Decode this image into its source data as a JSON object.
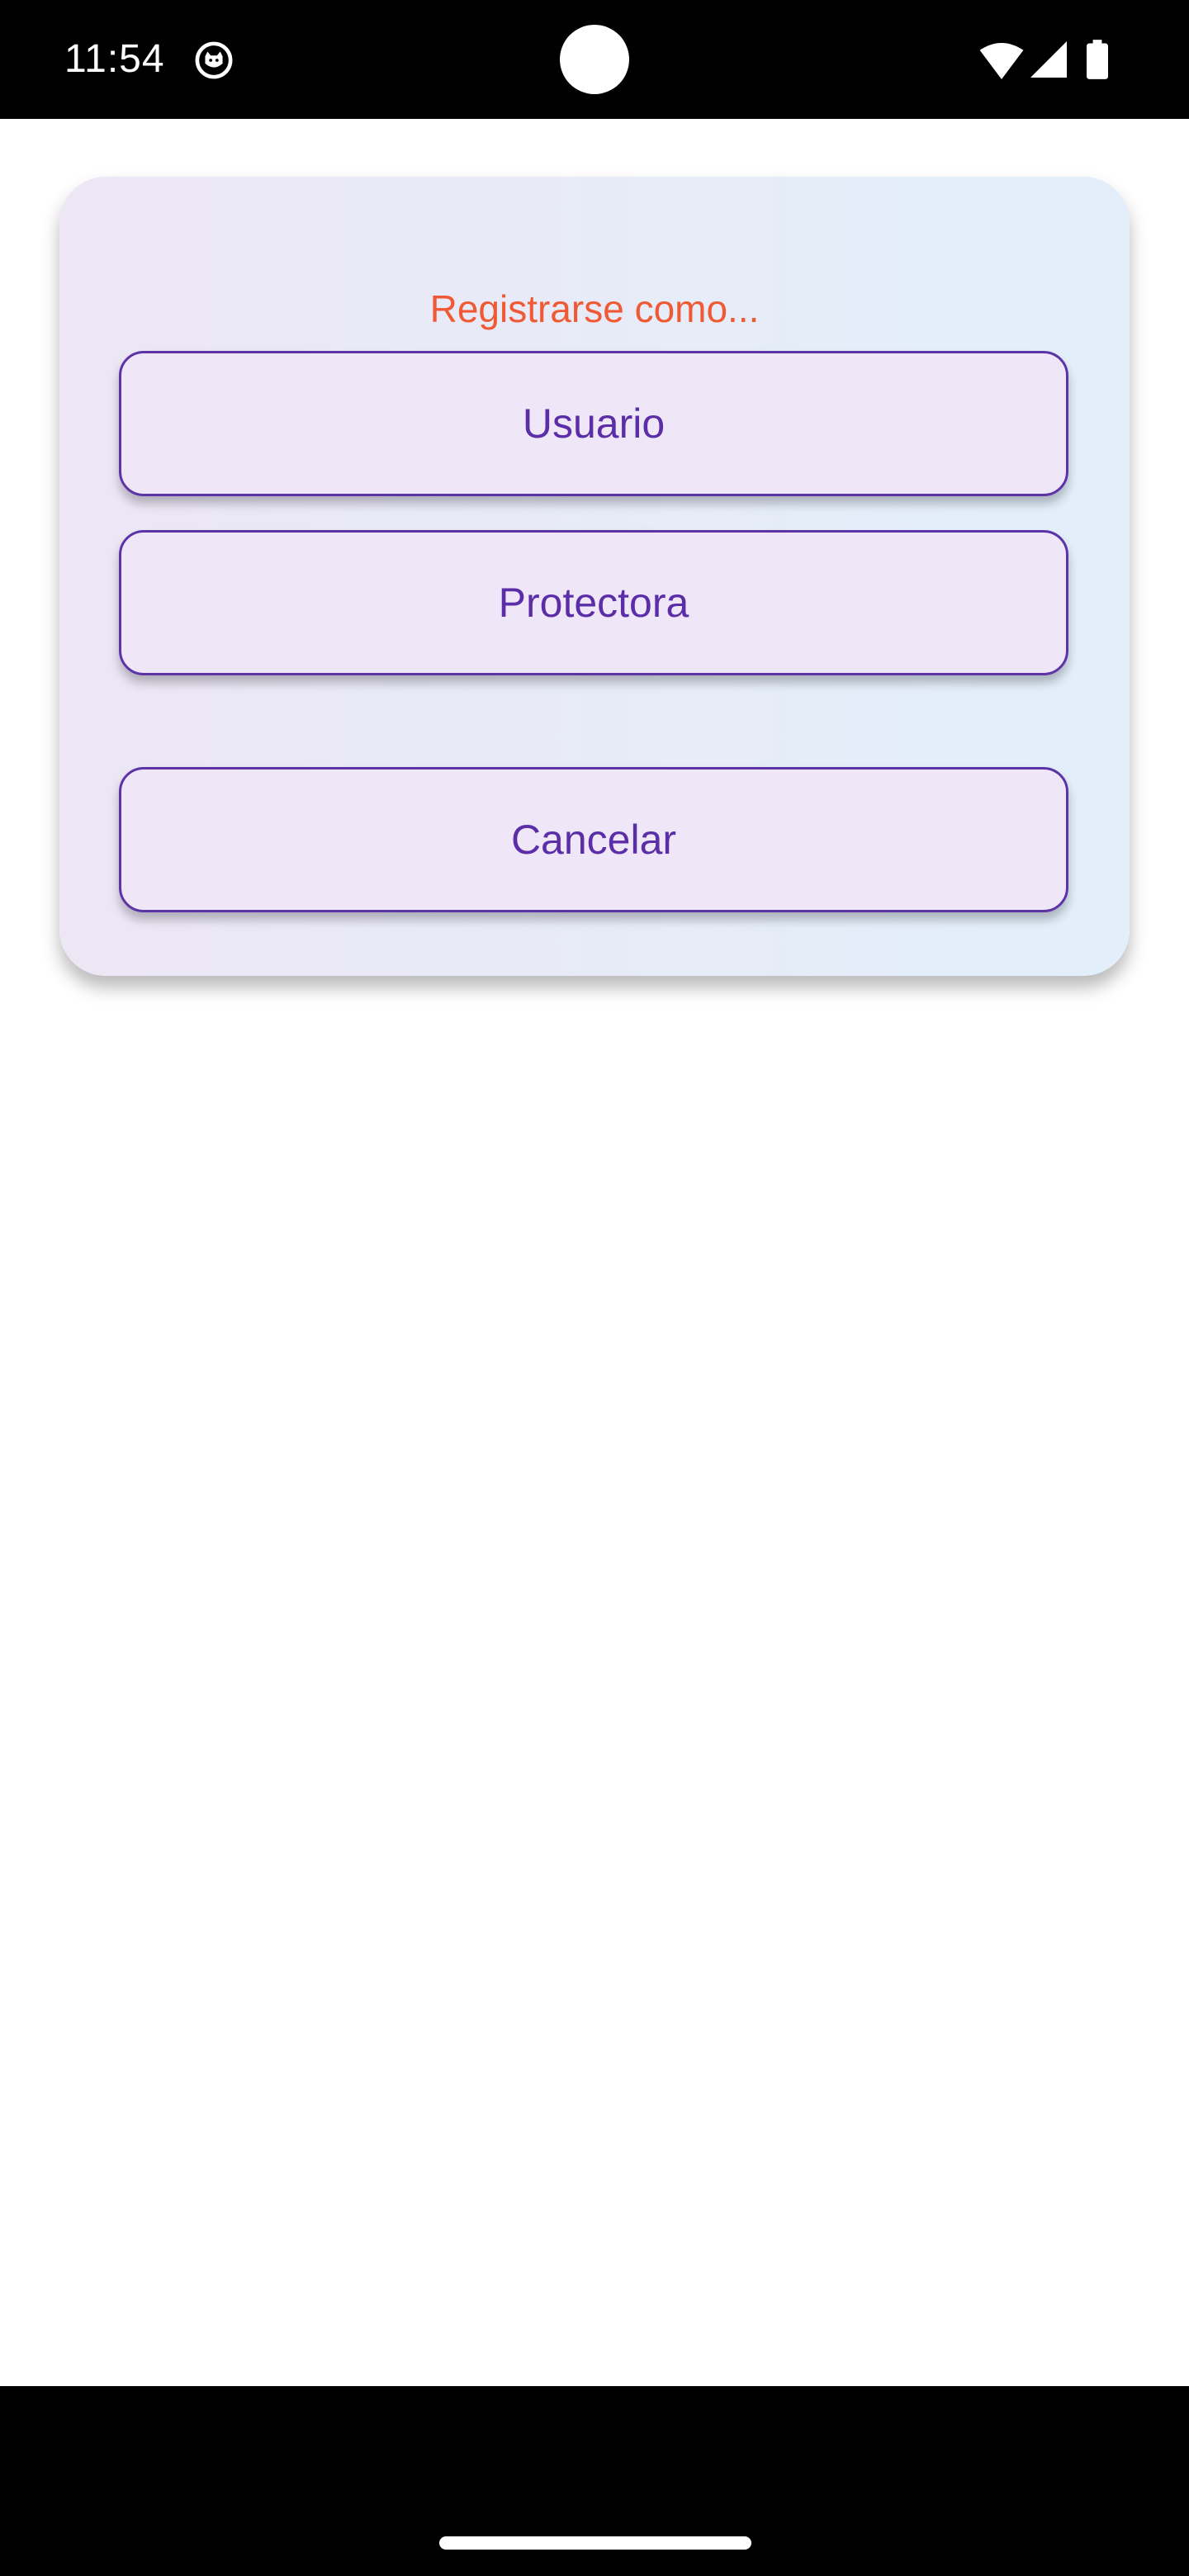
{
  "status_bar": {
    "time": "11:54",
    "app_icon": "app-notification-icon",
    "wifi_icon": "wifi-icon",
    "signal_icon": "signal-icon",
    "battery_icon": "battery-icon"
  },
  "dialog": {
    "title": "Registrarse como...",
    "options": [
      {
        "label": "Usuario"
      },
      {
        "label": "Protectora"
      }
    ],
    "cancel_label": "Cancelar"
  },
  "colors": {
    "title": "#ef5a35",
    "button_text": "#5b2ea8",
    "button_border": "#5c34a7",
    "button_fill": "#efe7f8",
    "card_gradient_start": "#ede6f5",
    "card_gradient_end": "#e2effb"
  }
}
